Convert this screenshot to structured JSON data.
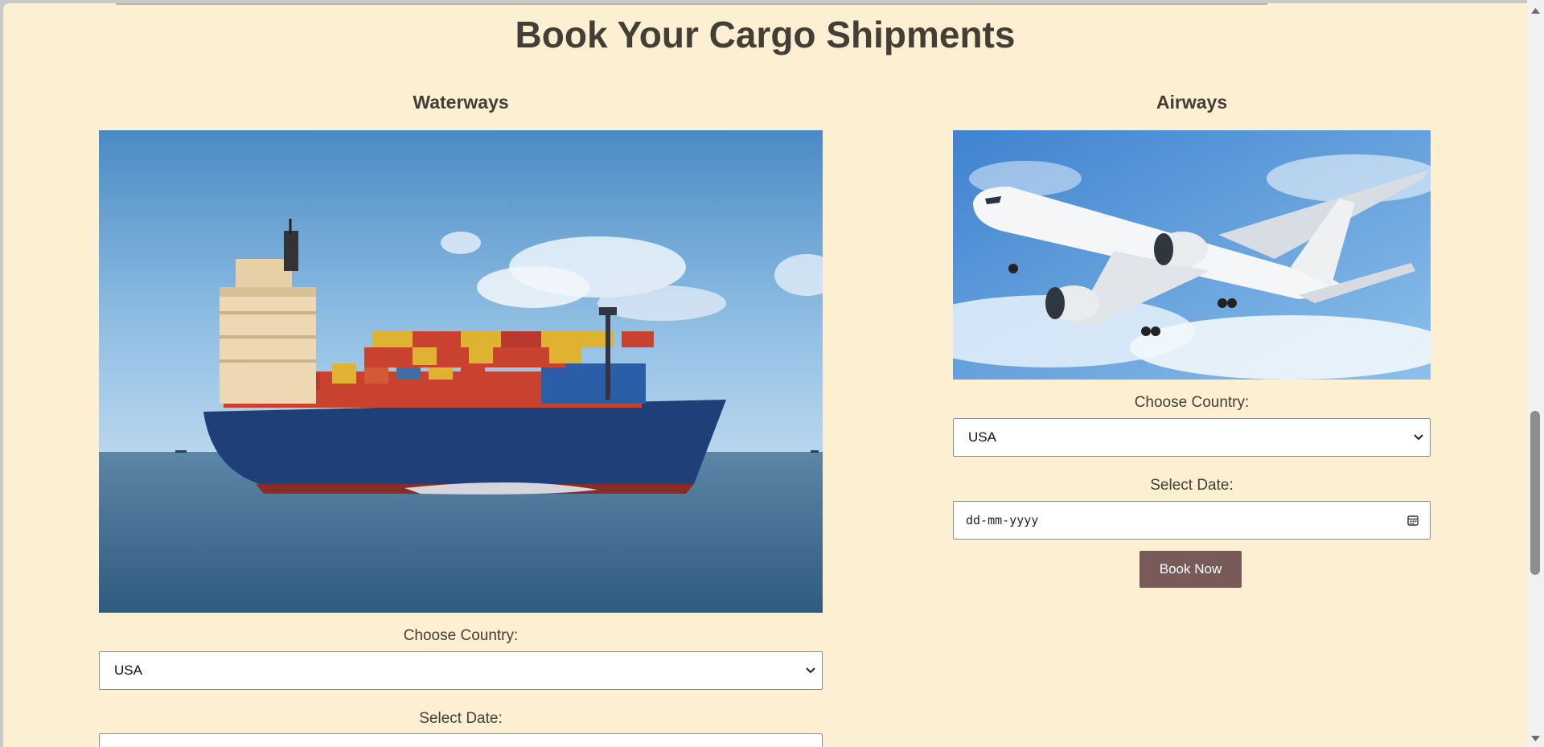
{
  "page": {
    "title": "Book Your Cargo Shipments"
  },
  "waterways": {
    "title": "Waterways",
    "image_icon": "cargo-ship-photo",
    "country_label": "Choose Country:",
    "country_value": "USA",
    "date_label": "Select Date:"
  },
  "airways": {
    "title": "Airways",
    "image_icon": "airplane-photo",
    "country_label": "Choose Country:",
    "country_value": "USA",
    "date_label": "Select Date:",
    "date_placeholder": "dd-mm-yyyy",
    "book_label": "Book Now"
  },
  "colors": {
    "background": "#fdefd1",
    "text": "#433f36",
    "button": "#785a59"
  }
}
